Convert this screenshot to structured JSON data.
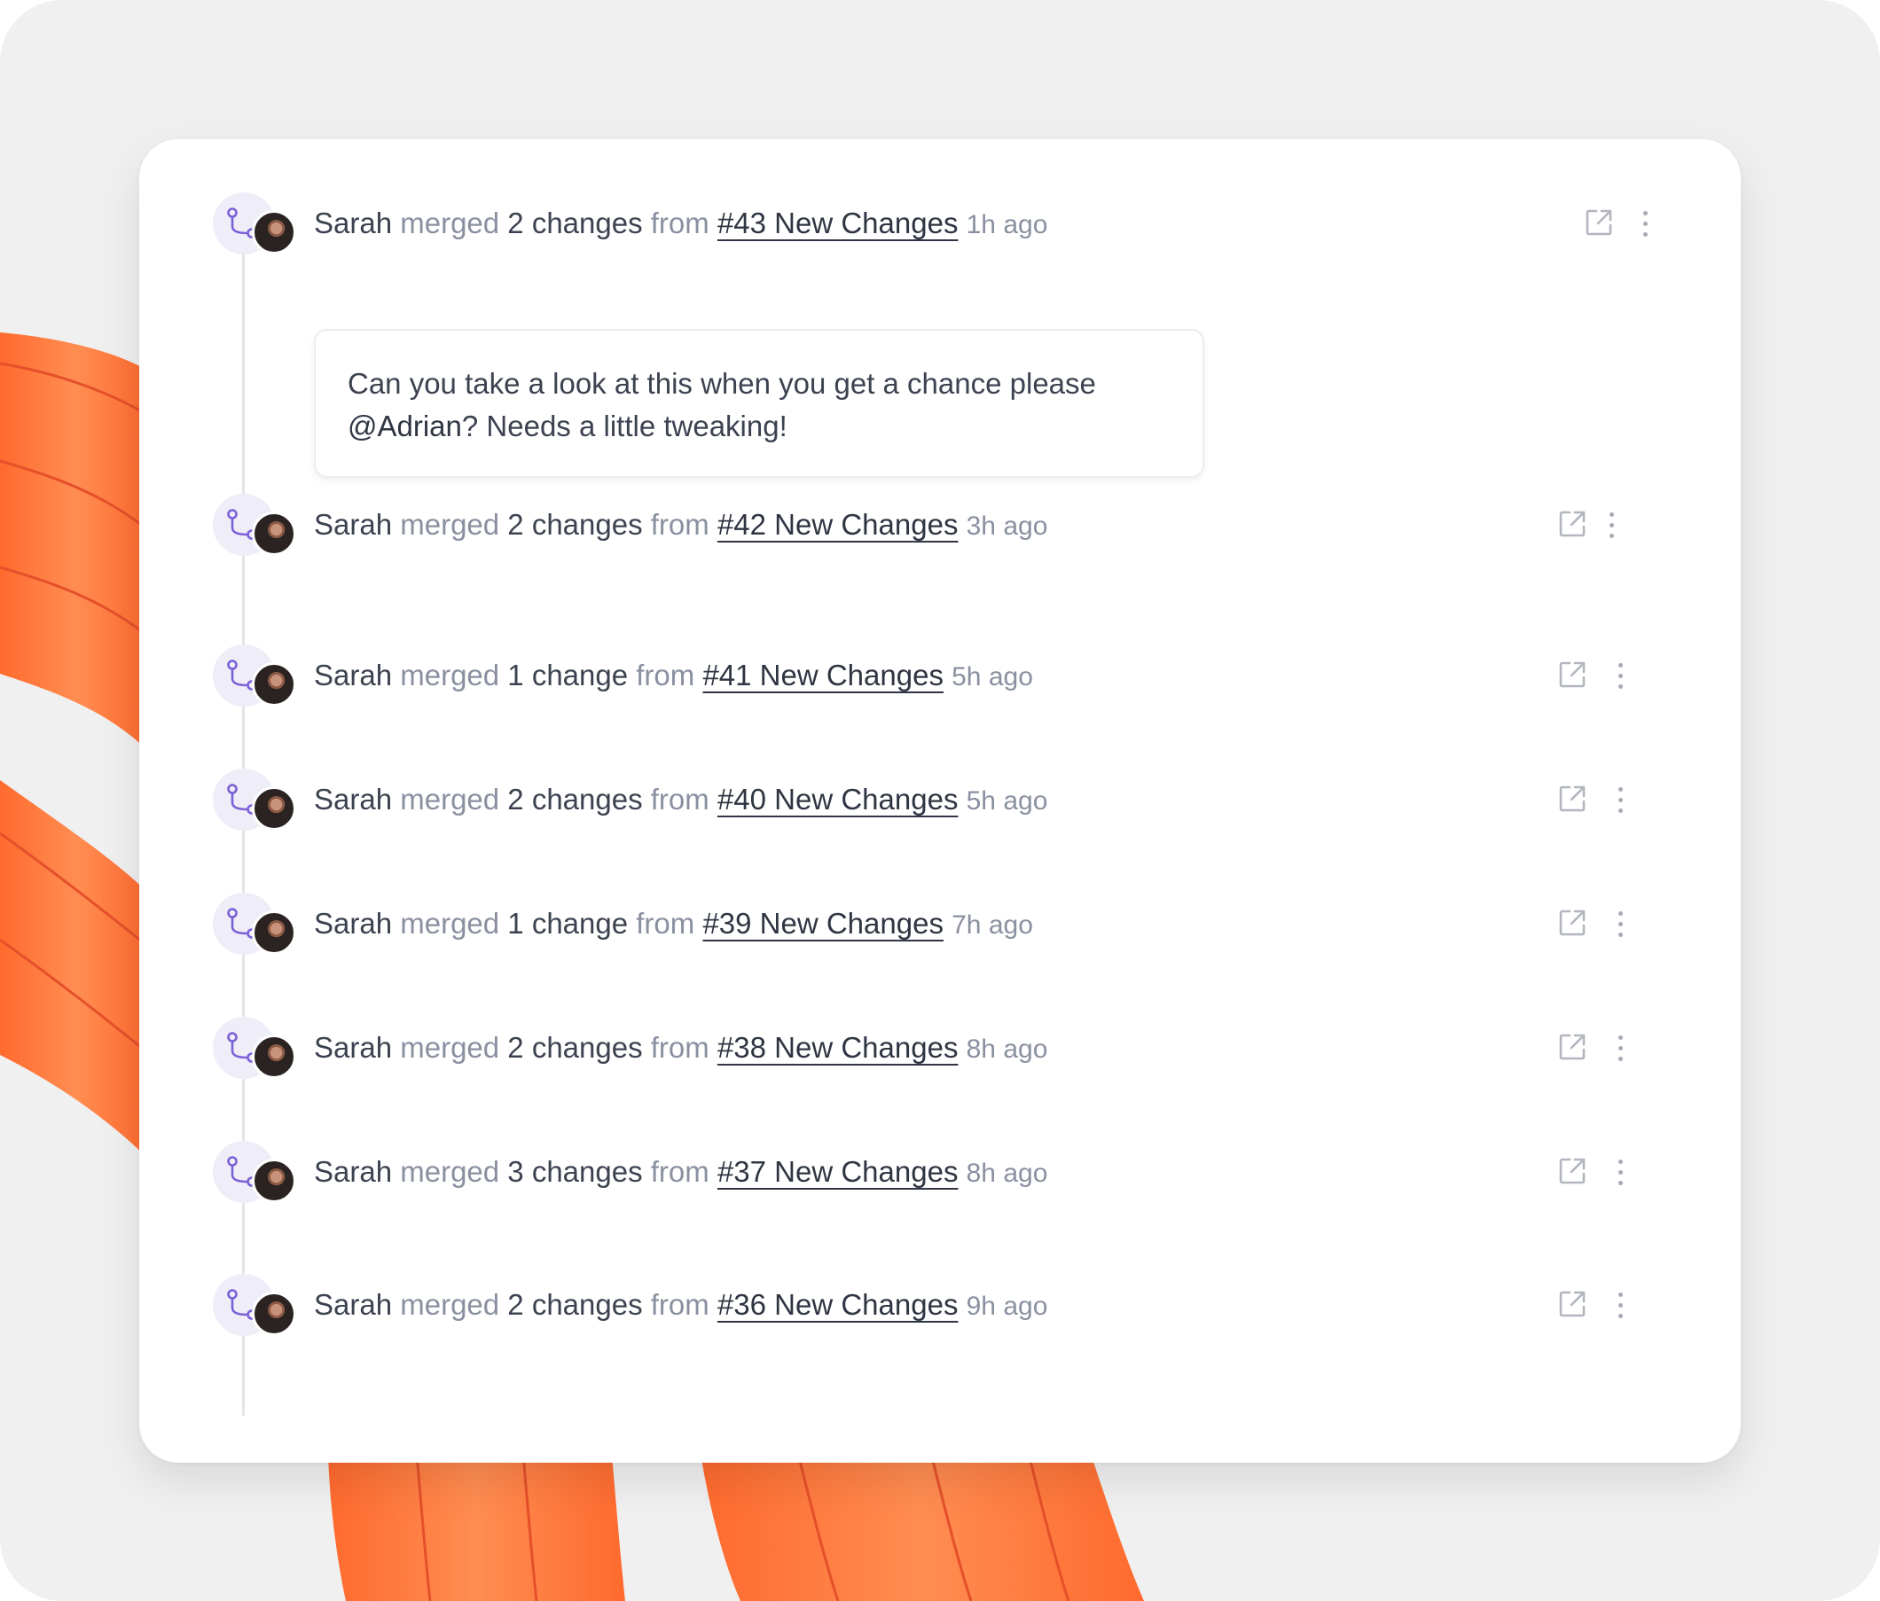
{
  "colors": {
    "background": "#f0f0f0",
    "card": "#ffffff",
    "accent_purple": "#7b61d6",
    "decor_orange": "#ff7a3d"
  },
  "icons": {
    "merge": "git-merge-icon",
    "external": "external-link-icon",
    "more": "more-vertical-icon"
  },
  "timeline": [
    {
      "user": "Sarah",
      "verb": "merged",
      "count": "2 changes",
      "preposition": "from",
      "link": "#43 New Changes",
      "time": "1h ago",
      "comment": {
        "text_before": "Can you take a look at this when you get a chance please ",
        "mention": "@Adrian",
        "text_after": "? Needs a little tweaking!"
      }
    },
    {
      "user": "Sarah",
      "verb": "merged",
      "count": "2 changes",
      "preposition": "from",
      "link": "#42 New Changes",
      "time": "3h ago"
    },
    {
      "user": "Sarah",
      "verb": "merged",
      "count": "1 change",
      "preposition": "from",
      "link": "#41 New Changes",
      "time": "5h ago"
    },
    {
      "user": "Sarah",
      "verb": "merged",
      "count": "2 changes",
      "preposition": "from",
      "link": "#40 New Changes",
      "time": "5h ago"
    },
    {
      "user": "Sarah",
      "verb": "merged",
      "count": "1 change",
      "preposition": "from",
      "link": "#39 New Changes",
      "time": "7h ago"
    },
    {
      "user": "Sarah",
      "verb": "merged",
      "count": "2 changes",
      "preposition": "from",
      "link": "#38 New Changes",
      "time": "8h ago"
    },
    {
      "user": "Sarah",
      "verb": "merged",
      "count": "3 changes",
      "preposition": "from",
      "link": "#37 New Changes",
      "time": "8h ago"
    },
    {
      "user": "Sarah",
      "verb": "merged",
      "count": "2 changes",
      "preposition": "from",
      "link": "#36 New Changes",
      "time": "9h ago"
    }
  ]
}
